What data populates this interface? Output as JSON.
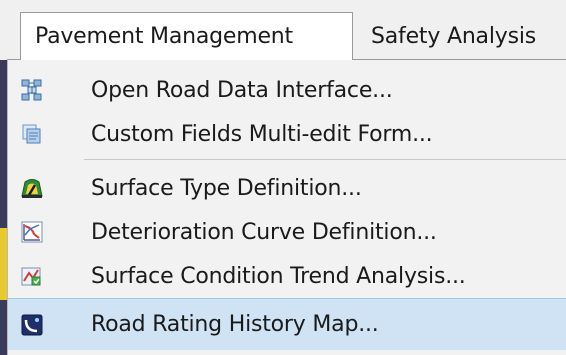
{
  "menubar": {
    "tabs": [
      {
        "label": "Pavement Management",
        "active": true
      },
      {
        "label": "Safety Analysis",
        "active": false
      }
    ]
  },
  "dropdown": {
    "items": [
      {
        "label": "Open Road Data Interface...",
        "icon": "road-data-grid-icon"
      },
      {
        "label": "Custom Fields Multi-edit Form...",
        "icon": "multi-edit-form-icon"
      },
      {
        "label": "Surface Type Definition...",
        "icon": "surface-type-icon"
      },
      {
        "label": "Deterioration Curve Definition...",
        "icon": "deterioration-curve-icon"
      },
      {
        "label": "Surface Condition Trend Analysis...",
        "icon": "trend-analysis-icon"
      },
      {
        "label": "Road Rating History Map...",
        "icon": "rating-history-map-icon",
        "highlighted": true
      }
    ]
  },
  "colors": {
    "highlight": "#cfe3f5",
    "menu_background": "#f2f2f2"
  }
}
